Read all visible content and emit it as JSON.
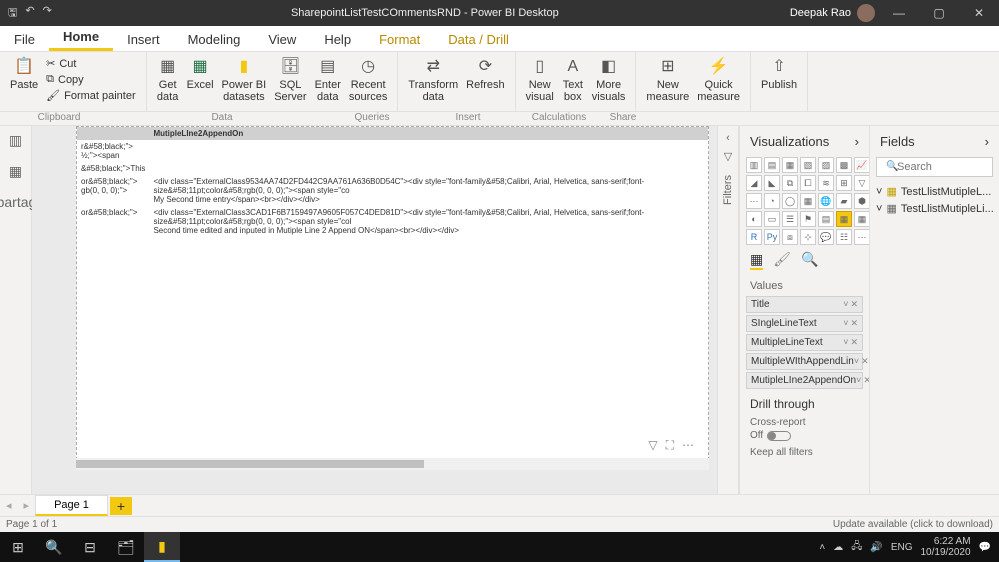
{
  "titlebar": {
    "title": "SharepointListTestCOmmentsRND - Power BI Desktop",
    "user": "Deepak Rao"
  },
  "tabs": {
    "file": "File",
    "home": "Home",
    "insert": "Insert",
    "modeling": "Modeling",
    "view": "View",
    "help": "Help",
    "format": "Format",
    "datadrill": "Data / Drill"
  },
  "ribbon": {
    "paste": "Paste",
    "cut": "Cut",
    "copy": "Copy",
    "formatpainter": "Format painter",
    "getdata": "Get\ndata",
    "excel": "Excel",
    "pbidatasets": "Power BI\ndatasets",
    "sqlserver": "SQL\nServer",
    "enterdata": "Enter\ndata",
    "recentsources": "Recent\nsources",
    "transform": "Transform\ndata",
    "refresh": "Refresh",
    "newvisual": "New\nvisual",
    "textbox": "Text\nbox",
    "morevisuals": "More\nvisuals",
    "newmeasure": "New\nmeasure",
    "quickmeasure": "Quick\nmeasure",
    "publish": "Publish",
    "grp_clipboard": "Clipboard",
    "grp_data": "Data",
    "grp_queries": "Queries",
    "grp_insert": "Insert",
    "grp_calc": "Calculations",
    "grp_share": "Share"
  },
  "filters": {
    "label": "Filters"
  },
  "viz": {
    "header": "Visualizations",
    "values": "Values",
    "wells": [
      "Title",
      "SIngleLineText",
      "MultipleLineText",
      "MultipleWIthAppendLin",
      "MutipleLIne2AppendOn"
    ],
    "drill": "Drill through",
    "crossreport": "Cross-report",
    "off": "Off",
    "keepall": "Keep all filters"
  },
  "fields": {
    "header": "Fields",
    "search_ph": "Search",
    "items": [
      "TestLlistMutipleL...",
      "TestLlistMutipleLi..."
    ]
  },
  "table": {
    "hdr": "MutipleLIne2AppendOn",
    "r1a": "r&#58;black;\">\n½;\"><span",
    "r2a": "&#58;black;\">This",
    "r3a": "or&#58;black;\">\ngb(0, 0, 0);\">",
    "r3b": "<div class=\"ExternalClass9534AA74D2FD442C9AA761A636B0D54C\"><div style=\"font-family&#58;Calibri, Arial, Helvetica, sans-serif;font-size&#58;11pt;color&#58;rgb(0, 0, 0);\"><span style=\"co\nMy Second time entry</span><br></div></div>",
    "r4a": "or&#58;black;\">",
    "r4b": "<div class=\"ExternalClass3CAD1F6B7159497A9605F057C4DED81D\"><div style=\"font-family&#58;Calibri, Arial, Helvetica, sans-serif;font-size&#58;11pt;color&#58;rgb(0, 0, 0);\"><span style=\"col\nSecond time edited and inputed in Mutiple Line 2 Append ON</span><br></div></div>"
  },
  "page": {
    "tab": "Page 1",
    "status": "Page 1 of 1",
    "update": "Update available (click to download)"
  },
  "tray": {
    "lang": "ENG",
    "time": "6:22 AM",
    "date": "10/19/2020"
  }
}
